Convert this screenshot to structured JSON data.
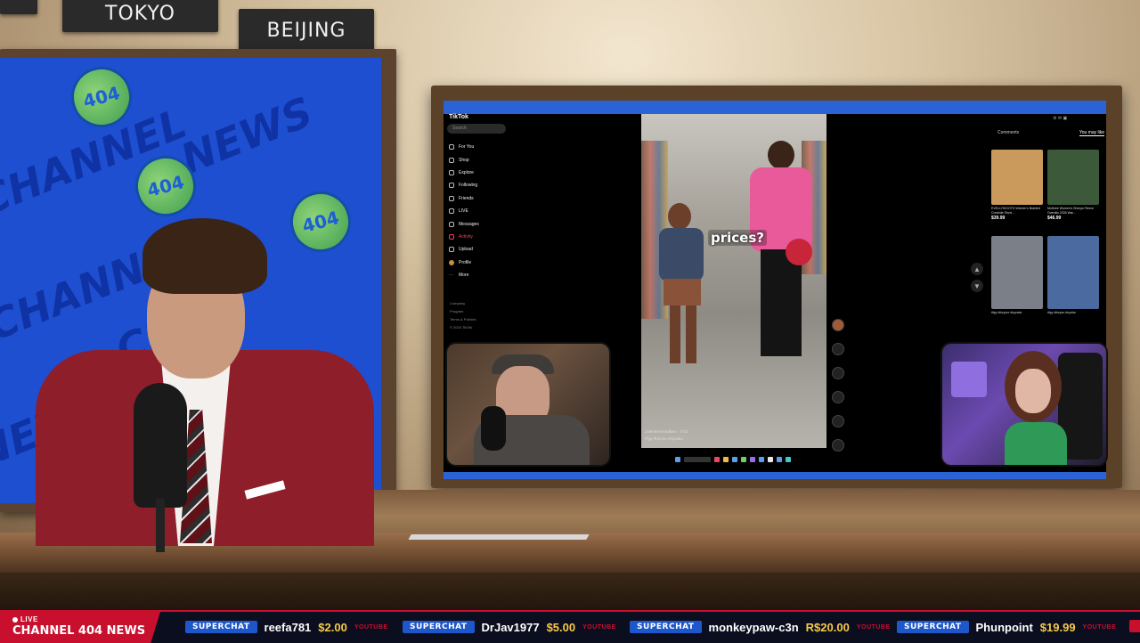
{
  "studio": {
    "clock_labels": [
      "TOKYO",
      "BEIJING"
    ]
  },
  "left_screen": {
    "watermark_texts": [
      "CHANNEL",
      "404",
      "NEWS",
      "CH"
    ]
  },
  "tiktok": {
    "logo": "TikTok",
    "search_placeholder": "Search",
    "nav": [
      {
        "label": "For You",
        "active": false
      },
      {
        "label": "Shop",
        "active": false
      },
      {
        "label": "Explore",
        "active": false
      },
      {
        "label": "Following",
        "active": false
      },
      {
        "label": "Friends",
        "active": false
      },
      {
        "label": "LIVE",
        "active": false
      },
      {
        "label": "Messages",
        "active": false
      },
      {
        "label": "Activity",
        "active": true
      },
      {
        "label": "Upload",
        "active": false
      },
      {
        "label": "Profile",
        "active": false
      },
      {
        "label": "More",
        "active": false
      }
    ],
    "footer": [
      "Company",
      "Program",
      "Terms & Policies",
      "© 2024 TikTok"
    ],
    "video": {
      "caption_overlay": "prices?",
      "author": "zalentosmeadlarn · 4-10",
      "tags": "#fyp #foryou #nyzabc"
    },
    "right_panel": {
      "tabs": [
        {
          "label": "Comments",
          "active": false
        },
        {
          "label": "You may like",
          "active": true
        }
      ],
      "products": [
        {
          "title": "EVELLYIKOOTD Women's Braided Cowhide Short...",
          "price": "$39.99",
          "color": "#c99a5c"
        },
        {
          "title": "Mothree Women's Sherpa Fleece Overalls 2026 War...",
          "price": "$46.99",
          "color": "#3c5a3a"
        },
        {
          "title": "#fyp #foryour #nyzabc",
          "price": "",
          "color": "#7a7f88"
        },
        {
          "title": "#fyp #foryou #nyzba",
          "price": "",
          "color": "#4a6aa0"
        }
      ]
    }
  },
  "ticker": {
    "live_label": "LIVE",
    "channel": "CHANNEL 404 NEWS",
    "superchats": [
      {
        "badge": "SUPERCHAT",
        "user": "reefa781",
        "amount": "$2.00",
        "source": "YOUTUBE"
      },
      {
        "badge": "SUPERCHAT",
        "user": "DrJav1977",
        "amount": "$5.00",
        "source": "YOUTUBE"
      },
      {
        "badge": "SUPERCHAT",
        "user": "monkeypaw-c3n",
        "amount": "R$20.00",
        "source": "YOUTUBE"
      },
      {
        "badge": "SUPERCHAT",
        "user": "Phunpoint",
        "amount": "$19.99",
        "source": "YOUTUBE"
      }
    ]
  }
}
